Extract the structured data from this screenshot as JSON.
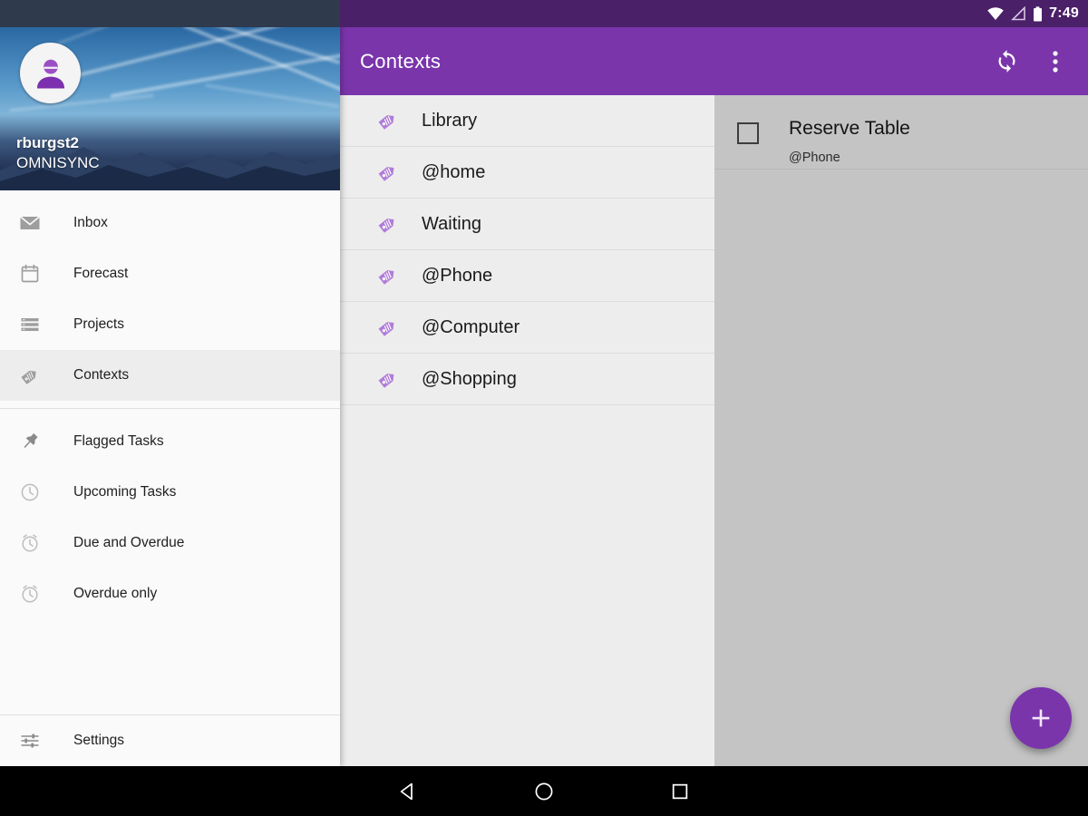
{
  "status_bar": {
    "time": "7:49",
    "icons": [
      "wifi-icon",
      "signal-icon",
      "battery-icon"
    ],
    "background": "#4a2068"
  },
  "app_bar": {
    "title": "Contexts",
    "background": "#7a35ab",
    "actions": [
      {
        "name": "sync-button",
        "icon": "sync-icon"
      },
      {
        "name": "overflow-menu-button",
        "icon": "more-vert-icon"
      }
    ]
  },
  "drawer": {
    "account": {
      "name": "rburgst2",
      "service": "OMNISYNC",
      "avatar": "person-avatar-icon"
    },
    "primary_items": [
      {
        "label": "Inbox",
        "icon": "inbox-envelope-icon",
        "selected": false
      },
      {
        "label": "Forecast",
        "icon": "calendar-icon",
        "selected": false
      },
      {
        "label": "Projects",
        "icon": "list-icon",
        "selected": false
      },
      {
        "label": "Contexts",
        "icon": "tag-icon",
        "selected": true
      }
    ],
    "secondary_items": [
      {
        "label": "Flagged Tasks",
        "icon": "pin-icon",
        "selected": false
      },
      {
        "label": "Upcoming Tasks",
        "icon": "clock-icon",
        "selected": false
      },
      {
        "label": "Due and Overdue",
        "icon": "alarm-icon",
        "selected": false
      },
      {
        "label": "Overdue only",
        "icon": "alarm-icon",
        "selected": false
      }
    ],
    "footer_item": {
      "label": "Settings",
      "icon": "tune-sliders-icon"
    }
  },
  "context_list": {
    "accent_color": "#b07cd8",
    "items": [
      {
        "label": "Library",
        "icon": "tag-icon"
      },
      {
        "label": "@home",
        "icon": "tag-icon"
      },
      {
        "label": "Waiting",
        "icon": "tag-icon"
      },
      {
        "label": "@Phone",
        "icon": "tag-icon"
      },
      {
        "label": "@Computer",
        "icon": "tag-icon"
      },
      {
        "label": "@Shopping",
        "icon": "tag-icon"
      }
    ]
  },
  "detail_pane": {
    "background": "#c4c4c4",
    "task": {
      "title": "Reserve Table",
      "subtitle": "@Phone",
      "checked": false
    },
    "fab": {
      "name": "add-task-fab",
      "icon": "plus-icon",
      "color": "#7a35ab"
    }
  },
  "system_nav": [
    {
      "name": "back-button",
      "icon": "back-triangle-icon"
    },
    {
      "name": "home-button",
      "icon": "home-circle-icon"
    },
    {
      "name": "recents-button",
      "icon": "recents-square-icon"
    }
  ]
}
